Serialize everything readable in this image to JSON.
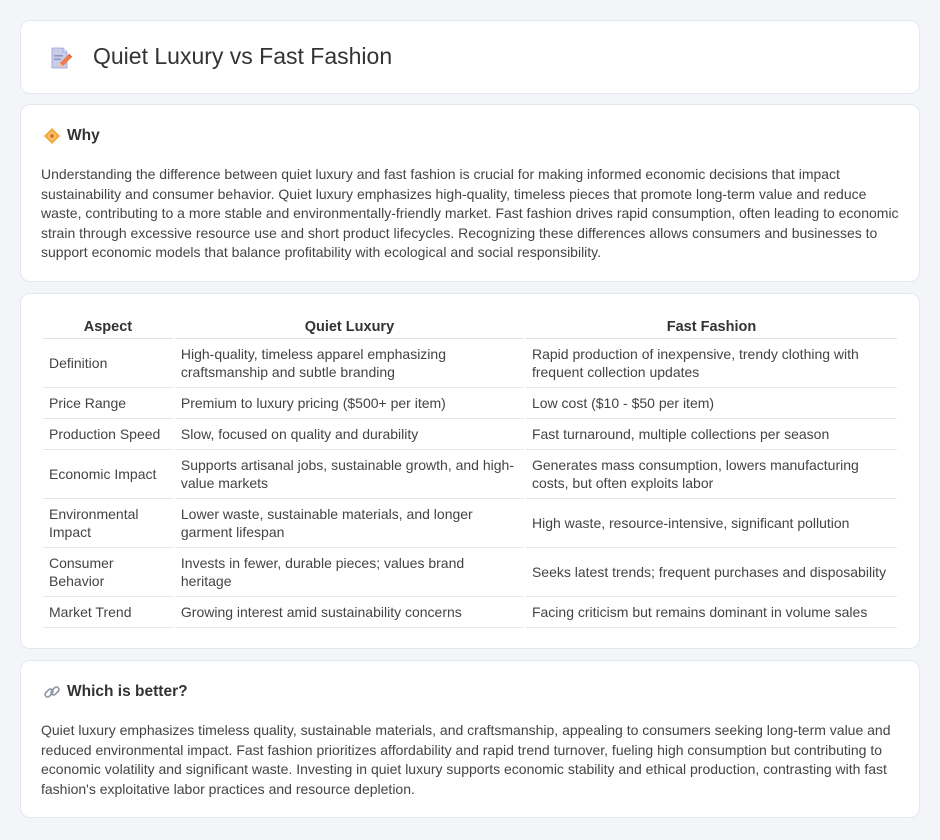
{
  "header": {
    "title": "Quiet Luxury vs Fast Fashion",
    "icon": "document-edit-icon"
  },
  "why": {
    "icon": "diamond-icon",
    "title": "Why",
    "text": "Understanding the difference between quiet luxury and fast fashion is crucial for making informed economic decisions that impact sustainability and consumer behavior. Quiet luxury emphasizes high-quality, timeless pieces that promote long-term value and reduce waste, contributing to a more stable and environmentally-friendly market. Fast fashion drives rapid consumption, often leading to economic strain through excessive resource use and short product lifecycles. Recognizing these differences allows consumers and businesses to support economic models that balance profitability with ecological and social responsibility."
  },
  "table": {
    "headers": [
      "Aspect",
      "Quiet Luxury",
      "Fast Fashion"
    ],
    "rows": [
      [
        "Definition",
        "High-quality, timeless apparel emphasizing craftsmanship and subtle branding",
        "Rapid production of inexpensive, trendy clothing with frequent collection updates"
      ],
      [
        "Price Range",
        "Premium to luxury pricing ($500+ per item)",
        "Low cost ($10 - $50 per item)"
      ],
      [
        "Production Speed",
        "Slow, focused on quality and durability",
        "Fast turnaround, multiple collections per season"
      ],
      [
        "Economic Impact",
        "Supports artisanal jobs, sustainable growth, and high-value markets",
        "Generates mass consumption, lowers manufacturing costs, but often exploits labor"
      ],
      [
        "Environmental Impact",
        "Lower waste, sustainable materials, and longer garment lifespan",
        "High waste, resource-intensive, significant pollution"
      ],
      [
        "Consumer Behavior",
        "Invests in fewer, durable pieces; values brand heritage",
        "Seeks latest trends; frequent purchases and disposability"
      ],
      [
        "Market Trend",
        "Growing interest amid sustainability concerns",
        "Facing criticism but remains dominant in volume sales"
      ]
    ]
  },
  "better": {
    "icon": "link-icon",
    "title": "Which is better?",
    "text": "Quiet luxury emphasizes timeless quality, sustainable materials, and craftsmanship, appealing to consumers seeking long-term value and reduced environmental impact. Fast fashion prioritizes affordability and rapid trend turnover, fueling high consumption but contributing to economic volatility and significant waste. Investing in quiet luxury supports economic stability and ethical production, contrasting with fast fashion's exploitative labor practices and resource depletion."
  }
}
